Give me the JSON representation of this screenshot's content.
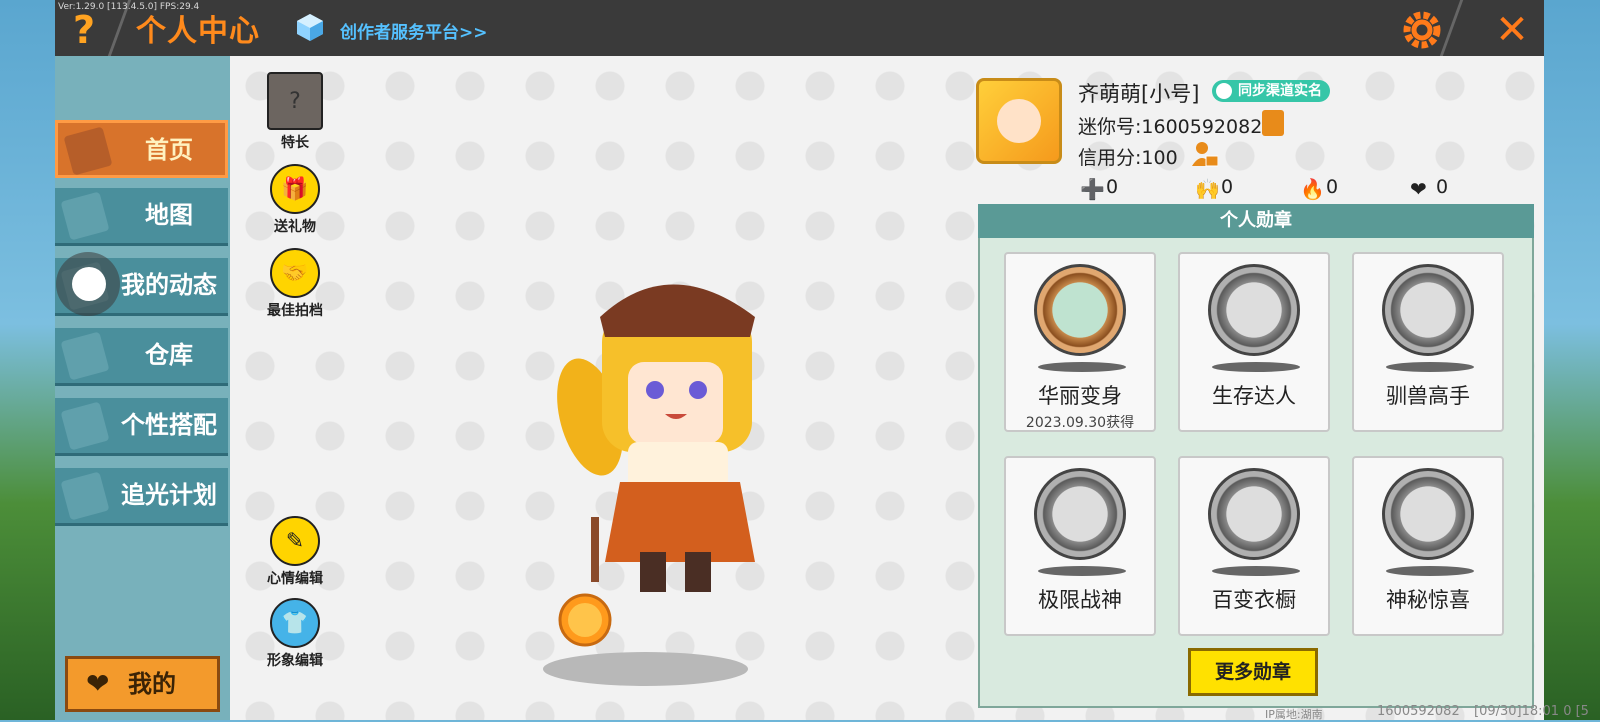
{
  "topbar": {
    "version": "Ver:1.29.0 [113.4.5.0] FPS:29.4",
    "help_label": "?",
    "title": "个人中心",
    "creator_link": "创作者服务平台>>",
    "close_label": "✕"
  },
  "sidebar": {
    "items": [
      {
        "label": "首页",
        "active": true
      },
      {
        "label": "地图"
      },
      {
        "label": "我的动态"
      },
      {
        "label": "仓库"
      },
      {
        "label": "个性搭配"
      },
      {
        "label": "追光计划"
      }
    ],
    "mine_label": "我的"
  },
  "actions": {
    "special": "特长",
    "gift": "送礼物",
    "best_partner": "最佳拍档",
    "mood_edit": "心情编辑",
    "avatar_edit": "形象编辑"
  },
  "profile": {
    "nickname": "齐萌萌[小号]",
    "realname_badge": "同步渠道实名",
    "mini_id": "迷你号:1600592082",
    "credit": "信用分:100",
    "stats": [
      {
        "icon": "add-friend-icon",
        "value": "0"
      },
      {
        "icon": "fans-icon",
        "value": "0"
      },
      {
        "icon": "fire-icon",
        "value": "0"
      },
      {
        "icon": "heart-icon",
        "value": "0"
      }
    ]
  },
  "medals": {
    "header": "个人勋章",
    "items": [
      {
        "name": "华丽变身",
        "date": "2023.09.30获得",
        "earned": true
      },
      {
        "name": "生存达人",
        "date": "",
        "earned": false
      },
      {
        "name": "驯兽高手",
        "date": "",
        "earned": false
      },
      {
        "name": "极限战神",
        "date": "",
        "earned": false
      },
      {
        "name": "百变衣橱",
        "date": "",
        "earned": false
      },
      {
        "name": "神秘惊喜",
        "date": "",
        "earned": false
      }
    ],
    "more_label": "更多勋章"
  },
  "footer": {
    "ip": "IP属地:湖南",
    "id": "1600592082",
    "time": "[09/30]18:01 0 [5"
  }
}
